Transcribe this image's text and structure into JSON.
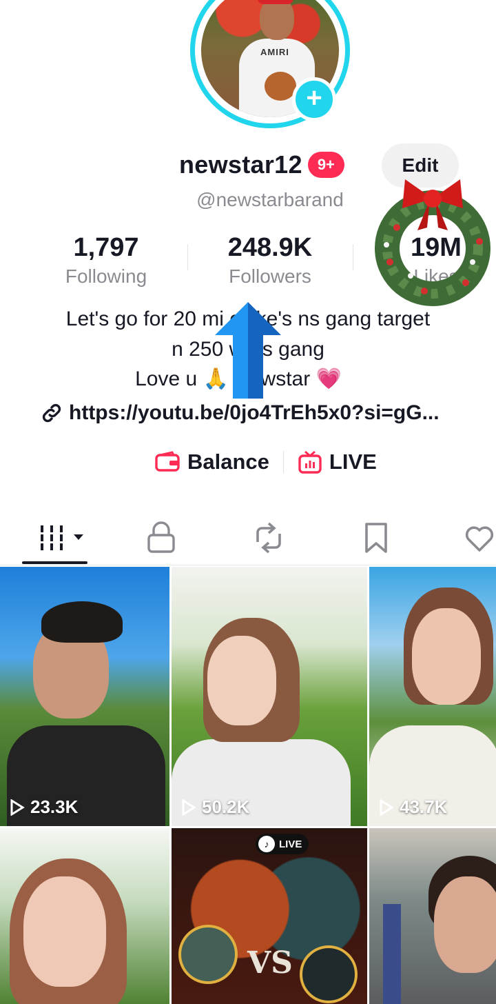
{
  "profile": {
    "username": "newstar12",
    "notification_badge": "9+",
    "edit_label": "Edit",
    "handle": "@newstarbarand",
    "avatar_brand_text": "AMIRI"
  },
  "stats": {
    "following": {
      "value": "1,797",
      "label": "Following"
    },
    "followers": {
      "value": "248.9K",
      "label": "Followers"
    },
    "likes": {
      "value": "19M",
      "label": "Likes"
    }
  },
  "bio": {
    "line1": "Let's go for 20 mi    e like's ns gang target",
    "line2": "n 250     wers gang",
    "line3": "Love u      🙏 Newstar",
    "heart": "💗",
    "link": "https://youtu.be/0jo4TrEh5x0?si=gG..."
  },
  "actions": {
    "balance": "Balance",
    "live": "LIVE"
  },
  "tabs": [
    {
      "name": "videos",
      "icon": "grid-bars-icon",
      "active": true
    },
    {
      "name": "private",
      "icon": "lock-icon",
      "active": false
    },
    {
      "name": "reposts",
      "icon": "repost-icon",
      "active": false
    },
    {
      "name": "favorites",
      "icon": "bookmark-icon",
      "active": false
    },
    {
      "name": "liked",
      "icon": "heart-icon",
      "active": false
    }
  ],
  "videos": [
    {
      "views": "23.3K"
    },
    {
      "views": "50.2K"
    },
    {
      "views": "43.7K"
    },
    {
      "views": ""
    },
    {
      "views": "",
      "live_chip": "LIVE"
    },
    {
      "views": ""
    }
  ],
  "colors": {
    "accent": "#fe2c55",
    "avatar_ring": "#20d5ec",
    "text_primary": "#161823",
    "text_secondary": "#8a8b91"
  }
}
